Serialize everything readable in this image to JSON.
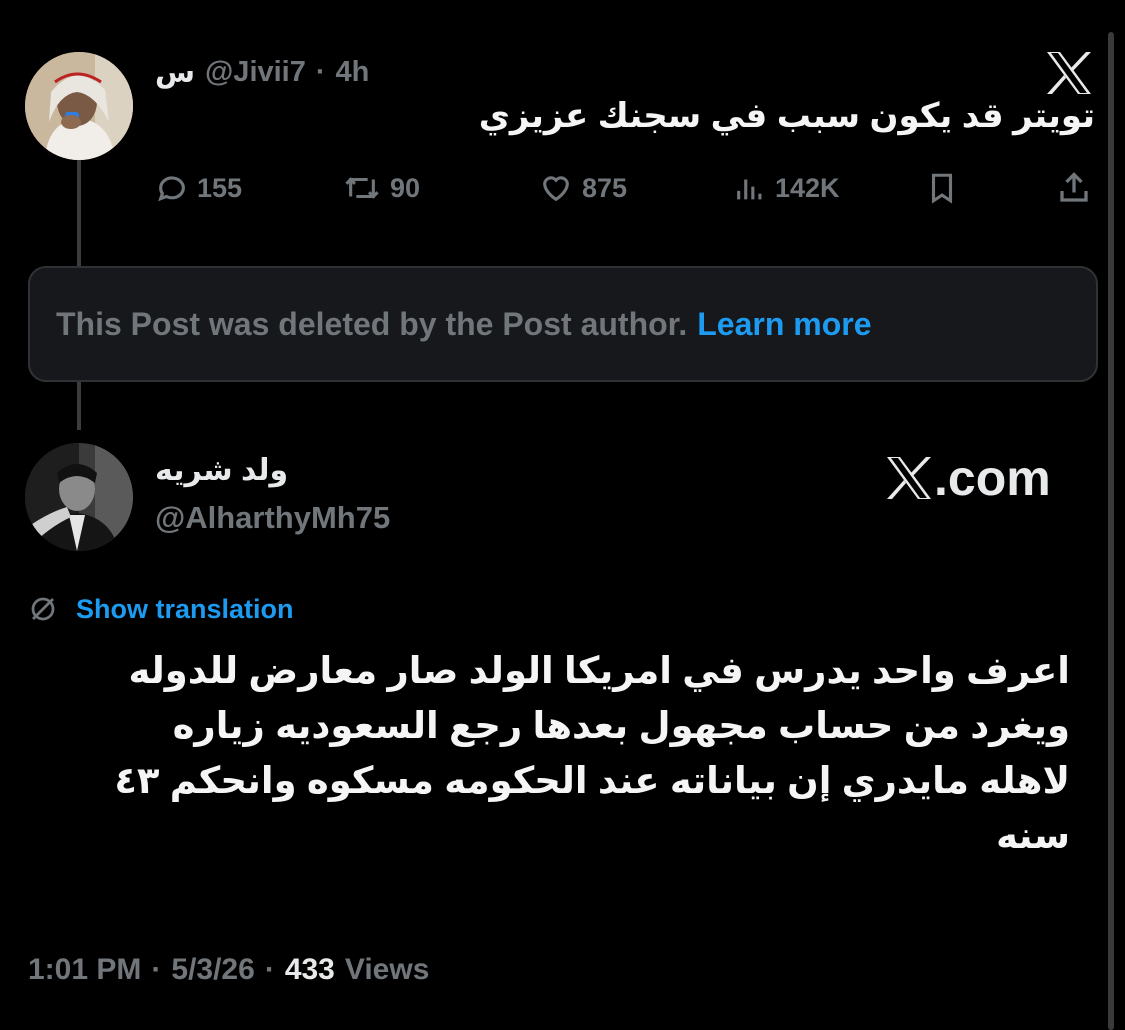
{
  "post1": {
    "name": "س",
    "handle": "@Jivii7",
    "separator": "·",
    "time": "4h",
    "text": "تويتر قد يكون سبب في سجنك عزيزي",
    "stats": {
      "replies": "155",
      "reposts": "90",
      "likes": "875",
      "views": "142K"
    }
  },
  "deleted": {
    "text": "This Post was deleted by the Post author.",
    "link": "Learn more"
  },
  "post2": {
    "name": "ولد شريه",
    "handle": "@AlharthyMh75",
    "watermark": ".com",
    "show_translation": "Show translation",
    "text_lines": [
      "اعرف واحد يدرس في امريكا الولد صار معارض للدوله",
      "ويغرد من حساب مجهول بعدها رجع السعوديه زياره",
      "لاهله مايدري إن بياناته عند الحكومه مسكوه وانحكم ٤٣",
      "سنه"
    ],
    "time": "1:01 PM",
    "date": "5/3/26",
    "views_count": "433",
    "views_label": "Views",
    "separator": "·"
  },
  "icons": {
    "x_logo": "x-logo-icon",
    "reply": "reply-icon",
    "repost": "repost-icon",
    "like": "heart-icon",
    "views": "views-icon",
    "bookmark": "bookmark-icon",
    "share": "share-icon",
    "translate": "translate-icon"
  }
}
